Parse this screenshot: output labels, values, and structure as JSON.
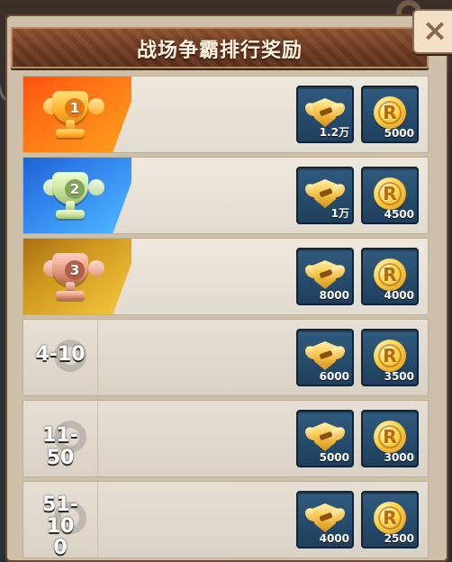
{
  "header": {
    "title": "战场争霸排行奖励"
  },
  "close": {
    "label": "×"
  },
  "ranks": [
    {
      "rank_num": "1",
      "rank_text": "",
      "rewards": [
        {
          "type": "badge",
          "count": "1.2万"
        },
        {
          "type": "coin",
          "count": "5000"
        }
      ]
    },
    {
      "rank_num": "2",
      "rank_text": "",
      "rewards": [
        {
          "type": "badge",
          "count": "1万"
        },
        {
          "type": "coin",
          "count": "4500"
        }
      ]
    },
    {
      "rank_num": "3",
      "rank_text": "",
      "rewards": [
        {
          "type": "badge",
          "count": "8000"
        },
        {
          "type": "coin",
          "count": "4000"
        }
      ]
    },
    {
      "rank_num": "",
      "rank_text": "4-10",
      "rewards": [
        {
          "type": "badge",
          "count": "6000"
        },
        {
          "type": "coin",
          "count": "3500"
        }
      ]
    },
    {
      "rank_num": "",
      "rank_text": "11-50",
      "rewards": [
        {
          "type": "badge",
          "count": "5000"
        },
        {
          "type": "coin",
          "count": "3000"
        }
      ]
    },
    {
      "rank_num": "",
      "rank_text_line1": "51-10",
      "rank_text_line2": "0",
      "rewards": [
        {
          "type": "badge",
          "count": "4000"
        },
        {
          "type": "coin",
          "count": "2500"
        }
      ]
    }
  ],
  "icons": {
    "badge": "badge-icon",
    "coin": "coin-icon",
    "trophy": "trophy-icon"
  },
  "colors": {
    "rank1": "#ff6d14",
    "rank2": "#2d7be9",
    "rank3": "#d0991f",
    "itemBg": "#2f5b7f"
  }
}
